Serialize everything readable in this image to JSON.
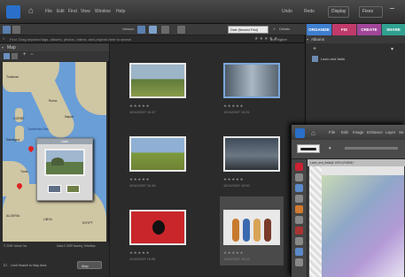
{
  "colors": {
    "organize": "#3f7fd0",
    "fix": "#c03a6a",
    "create": "#a0469a",
    "share": "#30a090",
    "accent_blue": "#2a6fc9"
  },
  "menubar": {
    "items": [
      "File",
      "Edit",
      "Find",
      "View",
      "Window",
      "Help"
    ],
    "right_items": [
      "Undo",
      "Redo",
      "Display",
      "Fixes"
    ]
  },
  "toolbar2": {
    "zoom_label": "Various",
    "date_label": "Date (Newest First)",
    "details_label": "Details",
    "tabs": [
      "ORGANIZE",
      "FIX",
      "CREATE",
      "SHARE"
    ]
  },
  "search": {
    "placeholder": "Find: Drag keyword tags, albums, photos, videos, and projects here to search",
    "rating_label": "and higher"
  },
  "map": {
    "title": "Map",
    "places": [
      "Toulouse",
      "CORSE",
      "Sardegna",
      "Tyrrhenian Sea",
      "Roma",
      "Napoli",
      "Palermo",
      "Tunis",
      "ALGERIA",
      "LIBYA",
      "EGYPT",
      "Malta",
      "Crete",
      "Cairo",
      "Athens"
    ],
    "copyright_left": "© 2009 Yahoo! Inc.",
    "copyright_right": "Data © 2009 Navteq, TeleAtlas",
    "limit_label": "Limit Search to Map Area",
    "map_button": "Map",
    "popup_title": "Lazio"
  },
  "grid": {
    "photos": [
      {
        "date": "10/10/2007 10:47",
        "stars": "★★★★★"
      },
      {
        "date": "10/10/2007 10:51",
        "stars": "★★★★★"
      },
      {
        "date": "10/10/2007 10:46",
        "stars": "★★★★★"
      },
      {
        "date": "10/10/2007 10:52",
        "stars": "★★★★★"
      },
      {
        "date": "11/10/2007 10:05",
        "stars": "★★★★★"
      },
      {
        "date": "12/10/2007 10:13",
        "stars": "★★★★★"
      }
    ]
  },
  "organize": {
    "header": "Albums",
    "item_label": "Lazio and Italia"
  },
  "editor": {
    "menu": [
      "File",
      "Edit",
      "Image",
      "Enhance",
      "Layer",
      "Se"
    ],
    "doc_tab": "Lazio_and_Italia@ 100% (RGB/8) *"
  }
}
